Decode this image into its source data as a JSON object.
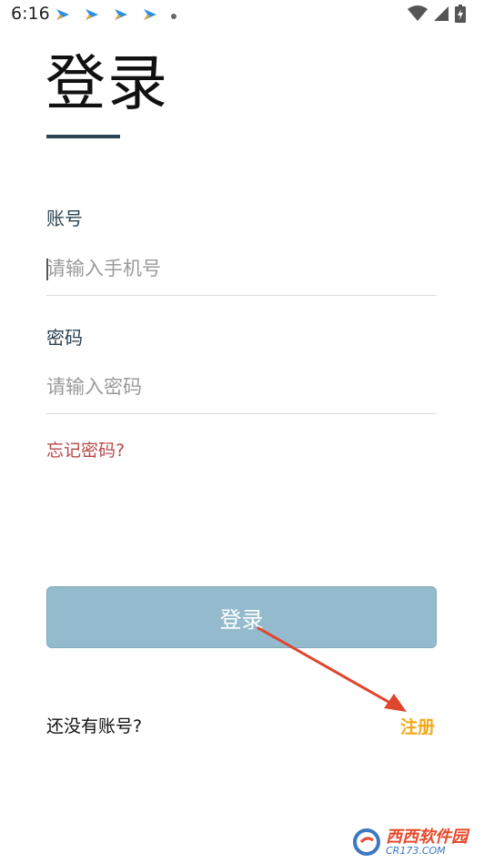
{
  "status_bar": {
    "time": "6:16"
  },
  "login": {
    "title": "登录",
    "account_label": "账号",
    "account_placeholder": "请输入手机号",
    "password_label": "密码",
    "password_placeholder": "请输入密码",
    "forgot_password": "忘记密码?",
    "login_button": "登录",
    "no_account_text": "还没有账号?",
    "register_link": "注册"
  },
  "watermark": {
    "brand": "西西软件园",
    "domain": "CR173.COM"
  },
  "colors": {
    "title_underline": "#2c4352",
    "label": "#2c4352",
    "forgot_link": "#b8474a",
    "login_button_bg": "#93bbcd",
    "register_link": "#f2a818",
    "annotation_arrow": "#e0452e"
  }
}
